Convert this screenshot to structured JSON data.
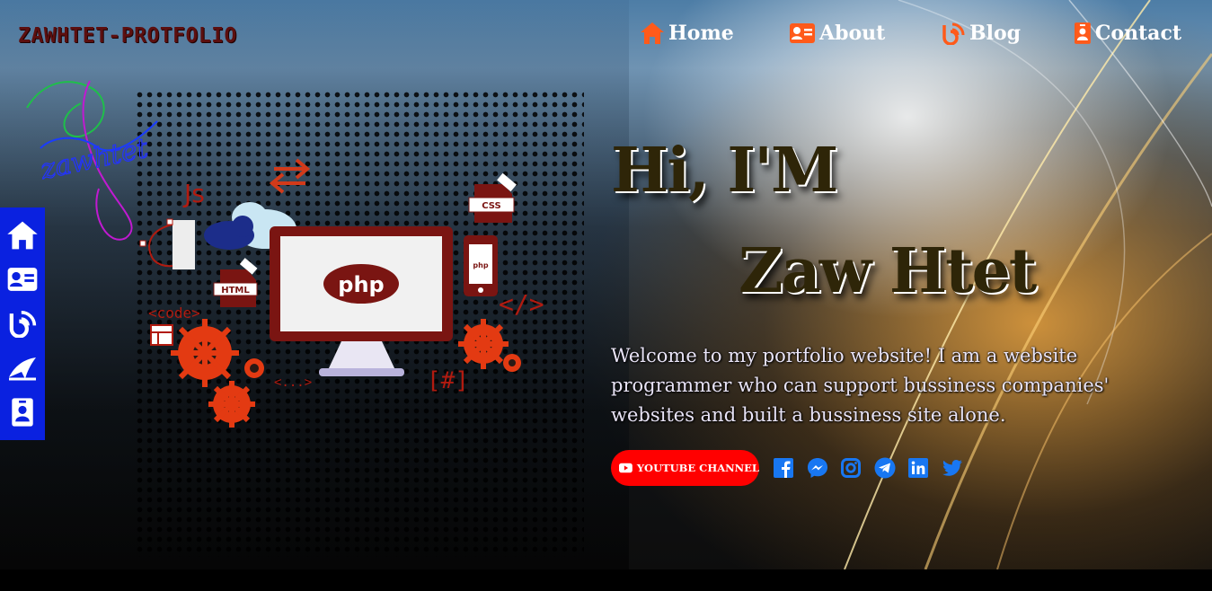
{
  "header": {
    "brand": "ZAWHTET-PROTFOLIO",
    "nav": [
      {
        "label": "Home",
        "icon": "home-icon"
      },
      {
        "label": "About",
        "icon": "id-card-icon"
      },
      {
        "label": "Blog",
        "icon": "blog-icon"
      },
      {
        "label": "Contact",
        "icon": "contact-icon"
      }
    ]
  },
  "sidebar": {
    "items": [
      "home-icon",
      "id-card-icon",
      "blog-icon",
      "paper-plane-icon",
      "contact-icon"
    ]
  },
  "hero": {
    "greeting": "Hi, I'M",
    "name": "Zaw Htet",
    "intro": "Welcome to my portfolio website! I am a website programmer who can support bussiness companies' websites and built a bussiness site alone.",
    "youtube_label": "YOUTUBE CHANNEL",
    "socials": [
      "facebook-icon",
      "messenger-icon",
      "instagram-icon",
      "telegram-icon",
      "linkedin-icon",
      "twitter-icon"
    ]
  },
  "illustration": {
    "signature": "zawhtet",
    "screen_text": "php",
    "labels": {
      "js": "Js",
      "css": "CSS",
      "html": "HTML",
      "code": "<code>",
      "tag": "</>",
      "dots": "<...>",
      "hash": "[#]",
      "phone": "php"
    }
  },
  "colors": {
    "accent_orange": "#ff5a1a",
    "sidebar_blue": "#0a21e0",
    "youtube_red": "#ff0000",
    "social_blue": "#1877f2",
    "brand_dark_red": "#5c0f0f",
    "heading_dark": "#2e2508"
  }
}
